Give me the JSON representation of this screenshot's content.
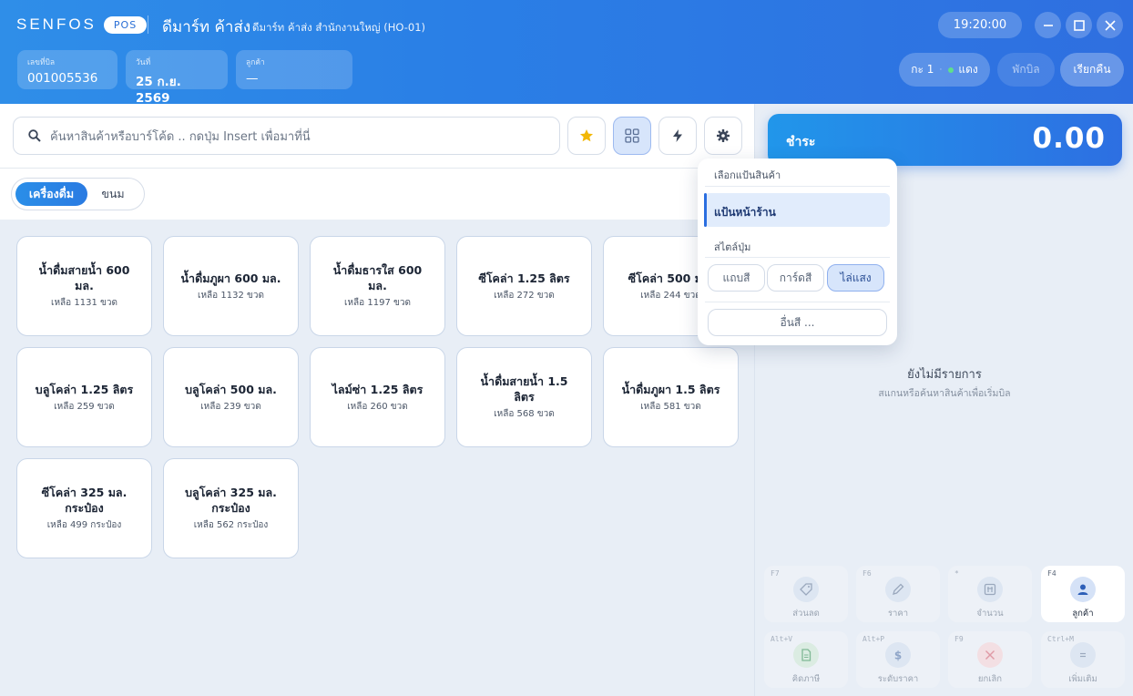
{
  "header": {
    "brand": "SENFOS",
    "brand_badge": "POS",
    "store_name": "ดีมาร์ท ค้าส่ง",
    "branch": "ดีมาร์ท ค้าส่ง สำนักงานใหญ่ (HO-01)",
    "time": "19:20:00",
    "bill_no_label": "เลขที่บิล",
    "bill_no": "001005536",
    "date_label": "วันที่",
    "date": "25 ก.ย. 2569",
    "customer_label": "ลูกค้า",
    "customer": "—",
    "shift_label": "กะ 1",
    "shift_sep": "·",
    "cashier": "แดง",
    "hold_label": "พักบิล",
    "recall_label": "เรียกคืน"
  },
  "search": {
    "placeholder": "ค้นหาสินค้าหรือบาร์โค้ด .. กดปุ่ม Insert เพื่อมาที่นี่"
  },
  "category_tabs": [
    {
      "label": "เครื่องดื่ม",
      "active": true
    },
    {
      "label": "ขนม",
      "active": false
    }
  ],
  "products": [
    {
      "name": "น้ำดื่มสายน้ำ 600 มล.",
      "stock": "เหลือ 1131 ขวด"
    },
    {
      "name": "น้ำดื่มภูผา 600 มล.",
      "stock": "เหลือ 1132 ขวด"
    },
    {
      "name": "น้ำดื่มธารใส 600 มล.",
      "stock": "เหลือ 1197 ขวด"
    },
    {
      "name": "ซีโคล่า 1.25 ลิตร",
      "stock": "เหลือ 272 ขวด"
    },
    {
      "name": "ซีโคล่า 500 มล.",
      "stock": "เหลือ 244 ขวด"
    },
    {
      "name": "บลูโคล่า 1.25 ลิตร",
      "stock": "เหลือ 259 ขวด"
    },
    {
      "name": "บลูโคล่า 500 มล.",
      "stock": "เหลือ 239 ขวด"
    },
    {
      "name": "ไลม์ซ่า 1.25 ลิตร",
      "stock": "เหลือ 260 ขวด"
    },
    {
      "name": "น้ำดื่มสายน้ำ 1.5 ลิตร",
      "stock": "เหลือ 568 ขวด"
    },
    {
      "name": "น้ำดื่มภูผา 1.5 ลิตร",
      "stock": "เหลือ 581 ขวด"
    },
    {
      "name": "ซีโคล่า 325 มล. กระป๋อง",
      "stock": "เหลือ 499 กระป๋อง"
    },
    {
      "name": "บลูโคล่า 325 มล. กระป๋อง",
      "stock": "เหลือ 562 กระป๋อง"
    }
  ],
  "payment": {
    "label": "ชำระ",
    "amount": "0.00"
  },
  "cart": {
    "empty_title": "ยังไม่มีรายการ",
    "empty_subtitle": "สแกนหรือค้นหาสินค้าเพื่อเริ่มบิล"
  },
  "function_keys": [
    {
      "key": "F7",
      "label": "ส่วนลด",
      "icon": "tag-icon",
      "active": false
    },
    {
      "key": "F6",
      "label": "ราคา",
      "icon": "pencil-icon",
      "active": false
    },
    {
      "key": "*",
      "label": "จำนวน",
      "icon": "quantity-icon",
      "active": false
    },
    {
      "key": "F4",
      "label": "ลูกค้า",
      "icon": "user-icon",
      "active": true
    },
    {
      "key": "Alt+V",
      "label": "คิดภาษี",
      "icon": "document-icon",
      "active": false
    },
    {
      "key": "Alt+P",
      "label": "ระดับราคา",
      "icon": "dollar-icon",
      "active": false
    },
    {
      "key": "F9",
      "label": "ยกเลิก",
      "icon": "cancel-icon",
      "active": false
    },
    {
      "key": "Ctrl+M",
      "label": "เพิ่มเติม",
      "icon": "menu-icon",
      "active": false
    }
  ],
  "dropdown": {
    "title": "เลือกแป้นสินค้า",
    "selected": "แป้นหน้าร้าน",
    "style_label": "สไตล์ปุ่ม",
    "styles": [
      {
        "label": "แถบสี",
        "active": false
      },
      {
        "label": "การ์ดสี",
        "active": false
      },
      {
        "label": "ไล่แสง",
        "active": true
      }
    ],
    "more_label": "อื่นสี ..."
  },
  "colors": {
    "accent": "#2a7fe6",
    "header_gradient_start": "#2f8ee8",
    "header_gradient_end": "#2f6fe0",
    "star": "#f2b705",
    "status_online": "#5fe08a"
  }
}
